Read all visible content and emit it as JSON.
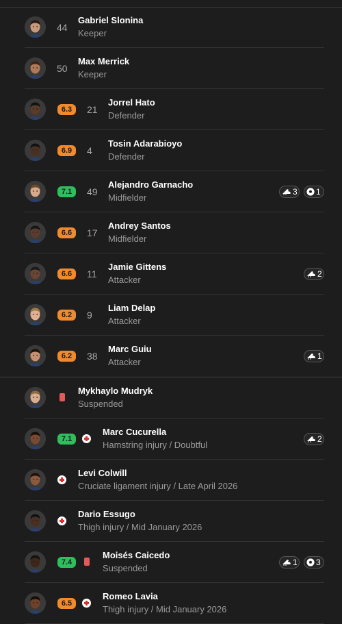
{
  "lineup": [
    {
      "name": "Gabriel Slonina",
      "position": "Keeper",
      "number": "44",
      "rating": null
    },
    {
      "name": "Max Merrick",
      "position": "Keeper",
      "number": "50",
      "rating": null
    },
    {
      "name": "Jorrel Hato",
      "position": "Defender",
      "number": "21",
      "rating": "6.3",
      "rating_color": "#f08a2c"
    },
    {
      "name": "Tosin Adarabioyo",
      "position": "Defender",
      "number": "4",
      "rating": "6.9",
      "rating_color": "#f08a2c"
    },
    {
      "name": "Alejandro Garnacho",
      "position": "Midfielder",
      "number": "49",
      "rating": "7.1",
      "rating_color": "#2fbe5e",
      "stats": [
        {
          "icon": "boot-icon",
          "value": "3"
        },
        {
          "icon": "ball-icon",
          "value": "1"
        }
      ]
    },
    {
      "name": "Andrey Santos",
      "position": "Midfielder",
      "number": "17",
      "rating": "6.6",
      "rating_color": "#f08a2c"
    },
    {
      "name": "Jamie Gittens",
      "position": "Attacker",
      "number": "11",
      "rating": "6.6",
      "rating_color": "#f08a2c",
      "stats": [
        {
          "icon": "boot-icon",
          "value": "2"
        }
      ]
    },
    {
      "name": "Liam Delap",
      "position": "Attacker",
      "number": "9",
      "rating": "6.2",
      "rating_color": "#f08a2c"
    },
    {
      "name": "Marc Guiu",
      "position": "Attacker",
      "number": "38",
      "rating": "6.2",
      "rating_color": "#f08a2c",
      "stats": [
        {
          "icon": "boot-icon",
          "value": "1"
        }
      ]
    }
  ],
  "unavailable": [
    {
      "name": "Mykhaylo Mudryk",
      "status": "Suspended",
      "status_icon": "red-card-icon",
      "rating": null
    },
    {
      "name": "Marc Cucurella",
      "status": "Hamstring injury / Doubtful",
      "status_icon": "injury-icon",
      "rating": "7.1",
      "rating_color": "#2fbe5e",
      "stats": [
        {
          "icon": "boot-icon",
          "value": "2"
        }
      ]
    },
    {
      "name": "Levi Colwill",
      "status": "Cruciate ligament injury / Late April 2026",
      "status_icon": "injury-icon",
      "rating": null
    },
    {
      "name": "Dario Essugo",
      "status": "Thigh injury / Mid January 2026",
      "status_icon": "injury-icon",
      "rating": null
    },
    {
      "name": "Moisés Caicedo",
      "status": "Suspended",
      "status_icon": "red-card-icon",
      "rating": "7.4",
      "rating_color": "#2fbe5e",
      "stats": [
        {
          "icon": "boot-icon",
          "value": "1"
        },
        {
          "icon": "ball-icon",
          "value": "3"
        }
      ]
    },
    {
      "name": "Romeo Lavia",
      "status": "Thigh injury / Mid January 2026",
      "status_icon": "injury-icon",
      "rating": "6.5",
      "rating_color": "#f08a2c"
    }
  ]
}
